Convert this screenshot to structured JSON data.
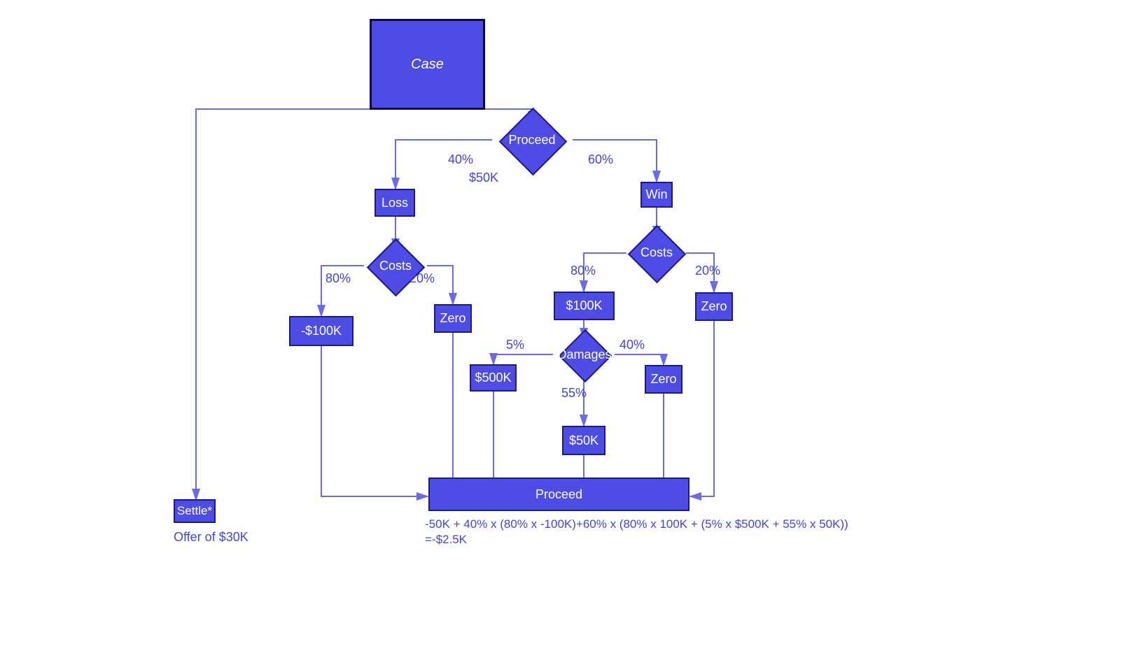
{
  "chart_data": {
    "type": "decision-tree",
    "title": "Case",
    "root": {
      "name": "Case",
      "branches": [
        {
          "name": "Settle*",
          "note": "Offer of $30K"
        },
        {
          "name": "Proceed",
          "cost": "$50K",
          "branches": [
            {
              "name": "Loss",
              "prob": "40%",
              "decision": "Costs",
              "branches": [
                {
                  "name": "-$100K",
                  "prob": "80%"
                },
                {
                  "name": "Zero",
                  "prob": "20%"
                }
              ]
            },
            {
              "name": "Win",
              "prob": "60%",
              "decision": "Costs",
              "branches": [
                {
                  "name": "$100K",
                  "prob": "80%",
                  "decision": "Damages",
                  "branches": [
                    {
                      "name": "$500K",
                      "prob": "5%"
                    },
                    {
                      "name": "$50K",
                      "prob": "55%"
                    },
                    {
                      "name": "Zero",
                      "prob": "40%"
                    }
                  ]
                },
                {
                  "name": "Zero",
                  "prob": "20%"
                }
              ]
            }
          ]
        }
      ]
    },
    "aggregation_node": "Proceed",
    "formula": "-50K + 40% x (80% x -100K)+60% x (80% x 100K + (5% x $500K + 55% x 50K))",
    "result": "=-$2.5K"
  },
  "nodes": {
    "case": "Case",
    "proceed_top": "Proceed",
    "loss": "Loss",
    "win": "Win",
    "costs_left": "Costs",
    "costs_right": "Costs",
    "neg100k": "-$100K",
    "zero_left": "Zero",
    "pos100k": "$100K",
    "zero_right": "Zero",
    "damages": "Damages",
    "d500k": "$500K",
    "d50k": "$50K",
    "dzero": "Zero",
    "proceed_bottom": "Proceed",
    "settle": "Settle*"
  },
  "edges": {
    "p40": "40%",
    "p60": "60%",
    "cost50k": "$50K",
    "p80a": "80%",
    "p20a": "20%",
    "p80b": "80%",
    "p20b": "20%",
    "p5": "5%",
    "p55": "55%",
    "p40d": "40%"
  },
  "notes": {
    "offer": "Offer of $30K",
    "formula": "-50K + 40% x (80% x -100K)+60% x (80% x 100K + (5% x $500K + 55% x 50K))",
    "result": "=-$2.5K"
  }
}
